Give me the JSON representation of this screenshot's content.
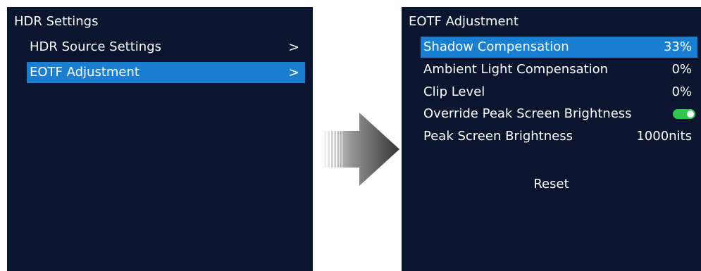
{
  "left_panel": {
    "title": "HDR Settings",
    "items": [
      {
        "label": "HDR Source Settings",
        "chevron": ">"
      },
      {
        "label": "EOTF Adjustment",
        "chevron": ">"
      }
    ]
  },
  "right_panel": {
    "title": "EOTF Adjustment",
    "items": [
      {
        "label": "Shadow Compensation",
        "value": "33%"
      },
      {
        "label": "Ambient Light Compensation",
        "value": "0%"
      },
      {
        "label": "Clip Level",
        "value": "0%"
      },
      {
        "label": "Override Peak Screen Brightness",
        "toggle": "on"
      },
      {
        "label": "Peak Screen Brightness",
        "value": "1000nits"
      }
    ],
    "reset_label": "Reset"
  },
  "icons": {
    "transition": "arrow-right-icon",
    "toggle": "toggle-switch-icon"
  },
  "colors": {
    "panel_background": "#0b1530",
    "selection_highlight": "#1a7fd0",
    "toggle_on": "#2dc84d",
    "text": "#ffffff"
  }
}
